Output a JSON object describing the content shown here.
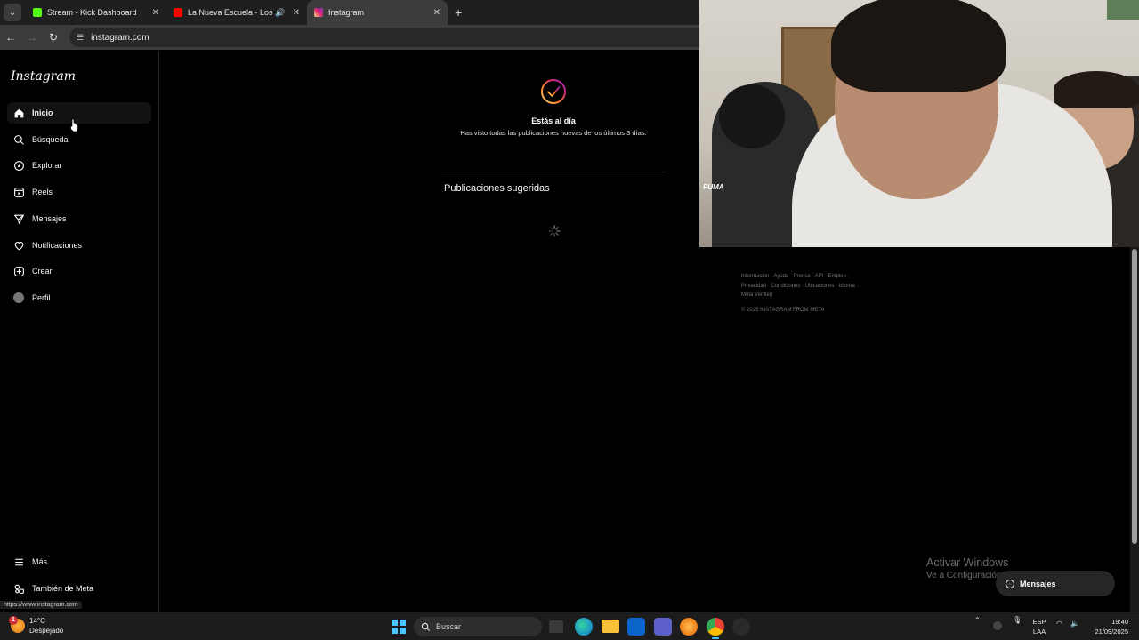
{
  "browser": {
    "tabs": [
      {
        "title": "Stream - Kick Dashboard",
        "favicon": "kick-icon",
        "active": false
      },
      {
        "title": "La Nueva Escuela - Los May",
        "favicon": "youtube-icon",
        "active": false,
        "audio": true
      },
      {
        "title": "Instagram",
        "favicon": "instagram-icon",
        "active": true
      }
    ],
    "url": "instagram.com",
    "status_url": "https://www.instagram.com"
  },
  "instagram": {
    "logo": "Instagram",
    "nav": [
      {
        "label": "Inicio",
        "icon": "home-icon",
        "active": true
      },
      {
        "label": "Búsqueda",
        "icon": "search-icon"
      },
      {
        "label": "Explorar",
        "icon": "compass-icon"
      },
      {
        "label": "Reels",
        "icon": "reels-icon"
      },
      {
        "label": "Mensajes",
        "icon": "send-icon"
      },
      {
        "label": "Notificaciones",
        "icon": "heart-icon"
      },
      {
        "label": "Crear",
        "icon": "plus-square-icon"
      },
      {
        "label": "Perfil",
        "icon": "avatar-icon"
      }
    ],
    "bottom_nav": [
      {
        "label": "Más",
        "icon": "menu-icon"
      },
      {
        "label": "También de Meta",
        "icon": "meta-threads-icon"
      }
    ],
    "feed": {
      "caught_up_title": "Estás al día",
      "caught_up_subtitle": "Has visto todas las publicaciones nuevas de los últimos 3 días.",
      "suggested_header": "Publicaciones sugeridas"
    },
    "footer": {
      "links_line1": "Información · Ayuda · Prensa · API · Empleo ·",
      "links_line2": "Privacidad · Condiciones · Ubicaciones · Idioma ·",
      "links_line3": "Meta Verified",
      "copyright": "© 2025 INSTAGRAM FROM META"
    },
    "messages_button": "Mensajes"
  },
  "webcam": {
    "shirt_logo": "PUMA"
  },
  "windows_watermark": {
    "title": "Activar Windows",
    "subtitle": "Ve a Configuración para activar Windows."
  },
  "taskbar": {
    "weather_temp": "14°C",
    "weather_desc": "Despejado",
    "weather_badge": "1",
    "search_placeholder": "Buscar",
    "lang_line1": "ESP",
    "lang_line2": "LAA",
    "time": "19:40",
    "date": "21/09/2025"
  },
  "colors": {
    "ig_background": "#000000",
    "accent_checkmark": "#d62976",
    "taskbar": "#1c1c1c",
    "windows_accent": "#4cc2ff"
  }
}
